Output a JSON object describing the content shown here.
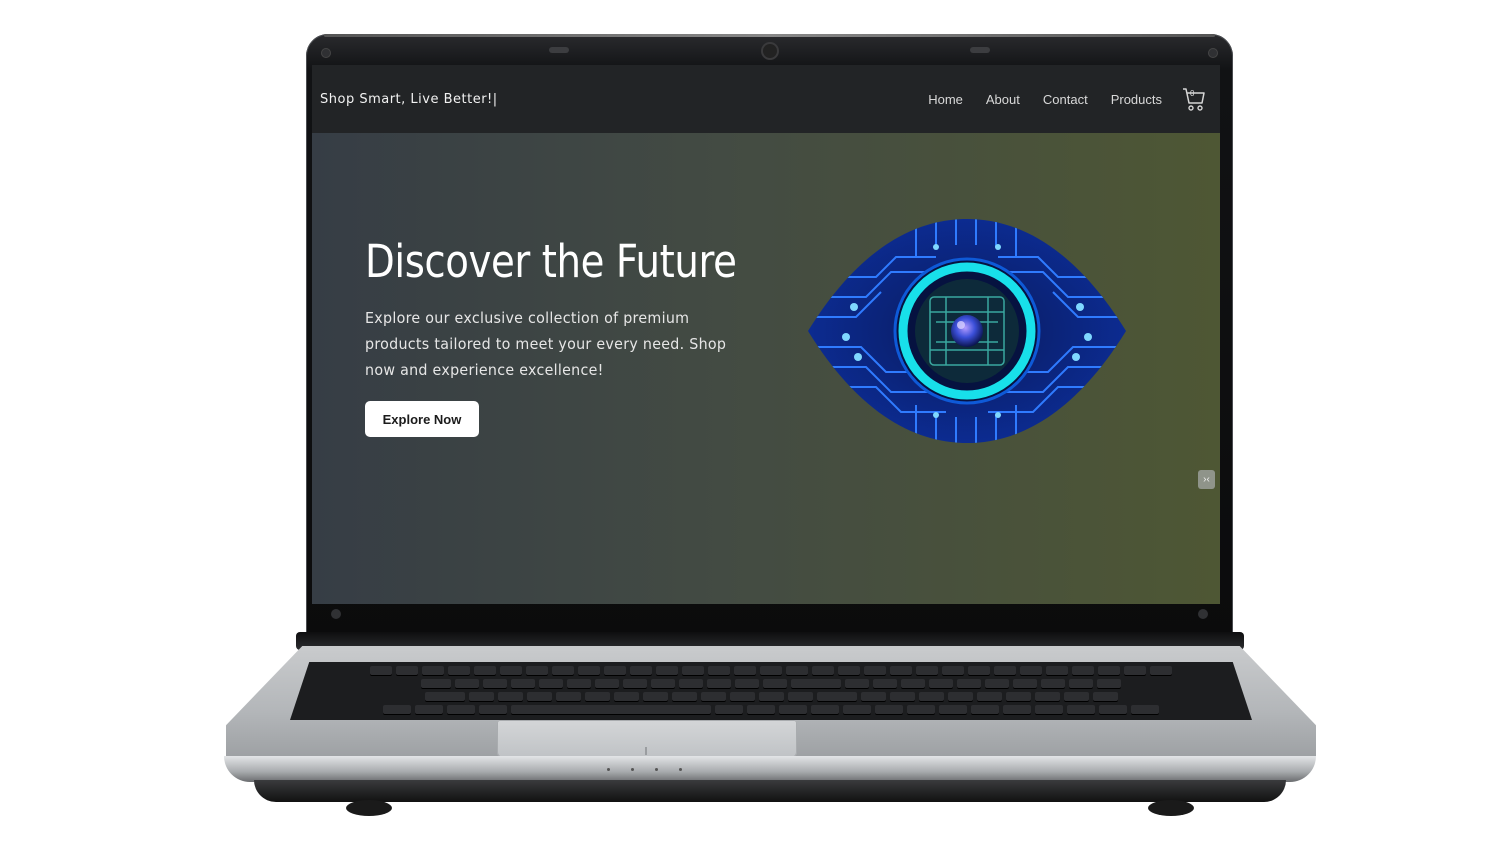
{
  "navbar": {
    "tagline": "Shop Smart, Live Better!|",
    "links": [
      {
        "label": "Home"
      },
      {
        "label": "About"
      },
      {
        "label": "Contact"
      },
      {
        "label": "Products"
      }
    ],
    "cart_count": "0",
    "cart_icon": "cart-icon"
  },
  "hero": {
    "title": "Discover the Future",
    "description": "Explore our exclusive collection of premium products tailored to meet your every need. Shop now and experience excellence!",
    "cta_label": "Explore Now",
    "image_icon": "circuit-eye-image",
    "side_handle_glyph": "›‹",
    "side_handle_icon": "collapse-icon"
  },
  "colors": {
    "navbar_bg": "#222426",
    "hero_gradient_start": "#363d45",
    "hero_gradient_end": "#4e5734",
    "cta_bg": "#ffffff",
    "eye_primary": "#1f4fd8",
    "eye_accent": "#18e0ea"
  }
}
